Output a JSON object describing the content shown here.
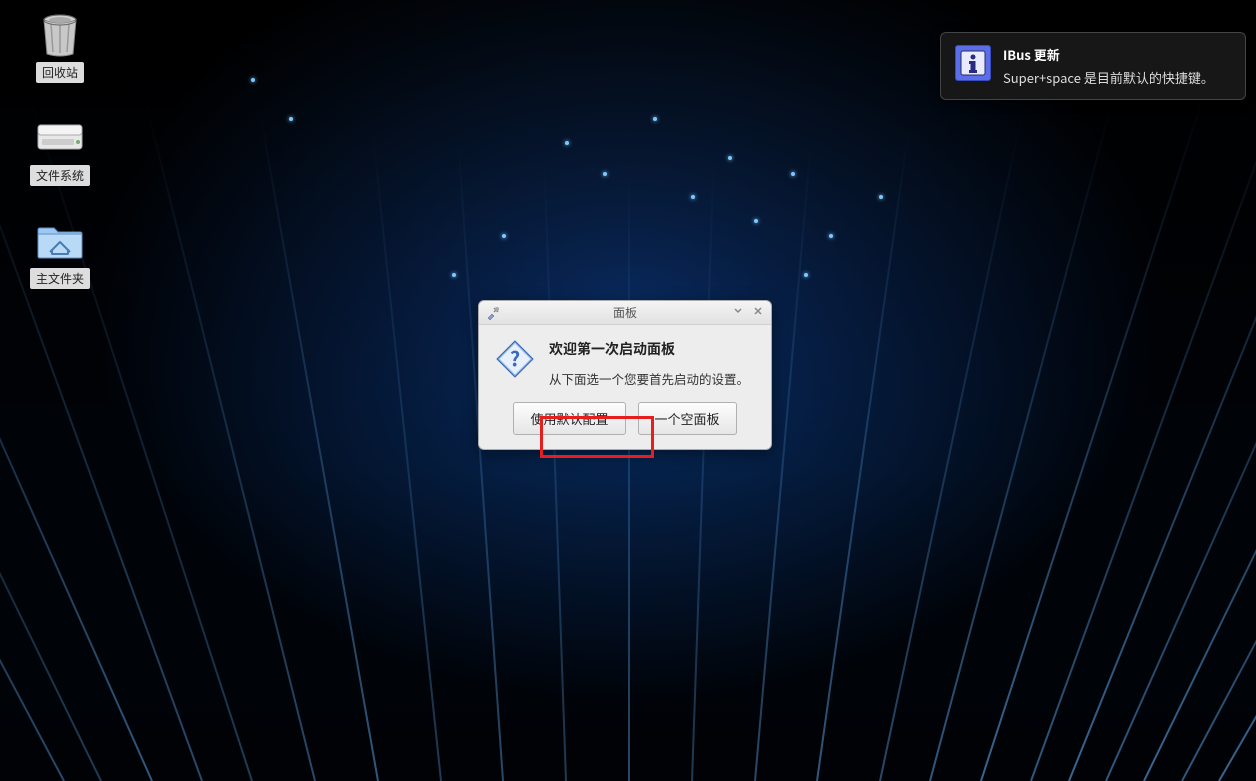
{
  "desktop": {
    "icons": [
      {
        "label": "回收站"
      },
      {
        "label": "文件系统"
      },
      {
        "label": "主文件夹"
      }
    ]
  },
  "dialog": {
    "title": "面板",
    "heading": "欢迎第一次启动面板",
    "message": "从下面选一个您要首先启动的设置。",
    "button_default": "使用默认配置",
    "button_empty": "一个空面板"
  },
  "notification": {
    "title": "IBus 更新",
    "body": "Super+space 是目前默认的快捷键。"
  }
}
